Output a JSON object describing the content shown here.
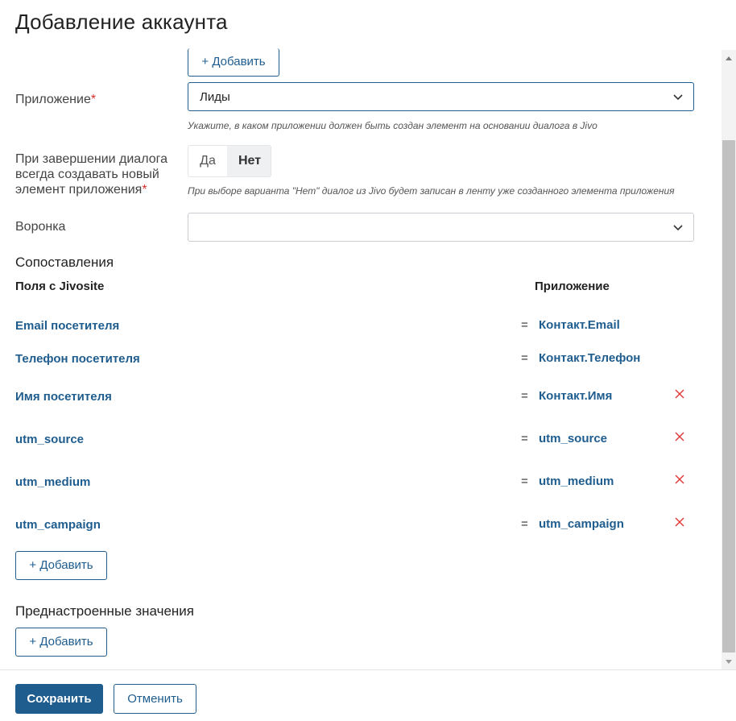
{
  "dialog": {
    "title": "Добавление аккаунта"
  },
  "top_add_button": "+ Добавить",
  "application": {
    "label": "Приложение",
    "required_mark": "*",
    "value": "Лиды",
    "hint": "Укажите, в каком приложении должен быть создан элемент на основании диалога в Jivo"
  },
  "on_finish": {
    "label_lines": [
      "При завершении диалога",
      "всегда создавать новый",
      "элемент приложения"
    ],
    "required_mark": "*",
    "options": [
      "Да",
      "Нет"
    ],
    "selected": "Нет",
    "hint": "При выборе варианта \"Нет\" диалог из Jivo будет записан в ленту уже созданного элемента приложения"
  },
  "funnel": {
    "label": "Воронка",
    "value": ""
  },
  "mappings": {
    "title": "Сопоставления",
    "col_source": "Поля с Jivosite",
    "col_target": "Приложение",
    "rows": [
      {
        "source": "Email посетителя",
        "eq": "=",
        "target": "Контакт.Email",
        "deletable": false
      },
      {
        "source": "Телефон посетителя",
        "eq": "=",
        "target": "Контакт.Телефон",
        "deletable": false
      },
      {
        "source": "Имя посетителя",
        "eq": "=",
        "target": "Контакт.Имя",
        "deletable": true
      },
      {
        "source": "utm_source",
        "eq": "=",
        "target": "utm_source",
        "deletable": true
      },
      {
        "source": "utm_medium",
        "eq": "=",
        "target": "utm_medium",
        "deletable": true
      },
      {
        "source": "utm_campaign",
        "eq": "=",
        "target": "utm_campaign",
        "deletable": true
      }
    ],
    "add_button": "+ Добавить"
  },
  "presets": {
    "title": "Преднастроенные значения",
    "add_button": "+ Добавить"
  },
  "footer": {
    "save": "Сохранить",
    "cancel": "Отменить"
  },
  "colors": {
    "accent": "#1f5d8f",
    "required": "#d62e2e",
    "delete": "#e03a3a"
  }
}
